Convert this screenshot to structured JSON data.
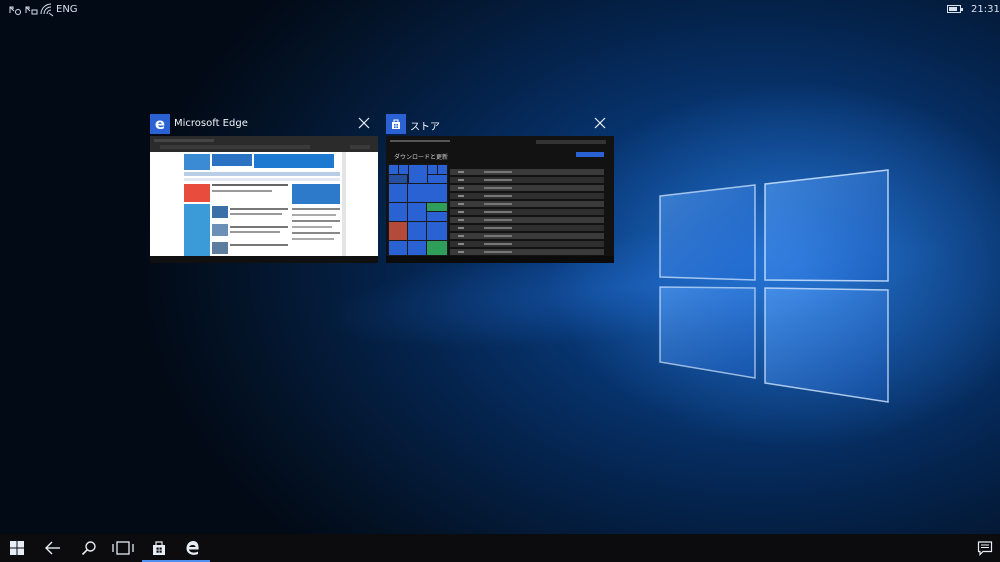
{
  "status_bar": {
    "language": "ENG",
    "time": "21:31",
    "battery_level": 0.75,
    "icons": [
      "missed-call-icon",
      "voicemail-icon",
      "wifi-signal-icon",
      "battery-icon"
    ]
  },
  "task_view": {
    "windows": [
      {
        "title": "Microsoft Edge",
        "icon": "edge-icon",
        "icon_glyph": "e"
      },
      {
        "title": "ストア",
        "icon": "store-icon",
        "store_heading": "ダウンロードと更新"
      }
    ]
  },
  "taskbar": {
    "buttons": [
      "start-icon",
      "back-icon",
      "search-icon",
      "task-view-icon",
      "store-icon",
      "edge-icon",
      "action-center-icon"
    ],
    "active": [
      "store-icon",
      "edge-icon"
    ]
  },
  "colors": {
    "accent": "#2a62d3",
    "taskbar_indicator": "#4f8ff0",
    "wallpaper": "#073571"
  }
}
